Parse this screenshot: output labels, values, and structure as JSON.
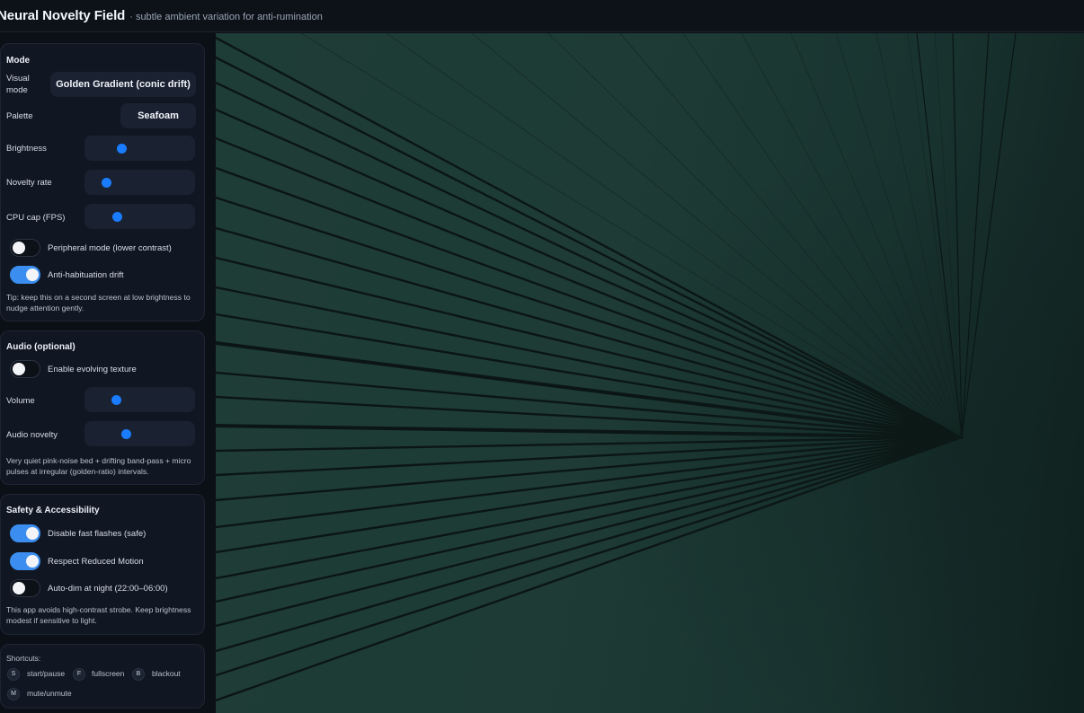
{
  "header": {
    "title": "Neural Novelty Field",
    "subtitle": "· subtle ambient variation for anti-rumination"
  },
  "mode": {
    "title": "Mode",
    "visual_mode_label": "Visual mode",
    "visual_mode_value": "Golden Gradient (conic drift)",
    "palette_label": "Palette",
    "palette_value": "Seafoam",
    "brightness_label": "Brightness",
    "brightness_value": 0.34,
    "novelty_rate_label": "Novelty rate",
    "novelty_rate_value": 0.2,
    "cpu_cap_label": "CPU cap (FPS)",
    "cpu_cap_value": 0.3,
    "peripheral_label": "Peripheral mode (lower contrast)",
    "peripheral_on": false,
    "anti_habituation_label": "Anti-habituation drift",
    "anti_habituation_on": true,
    "tip": "Tip: keep this on a second screen at low brightness to nudge attention gently."
  },
  "audio": {
    "title": "Audio (optional)",
    "enable_label": "Enable evolving texture",
    "enable_on": false,
    "volume_label": "Volume",
    "volume_value": 0.29,
    "audio_novelty_label": "Audio novelty",
    "audio_novelty_value": 0.38,
    "note": "Very quiet pink-noise bed + drifting band-pass + micro pulses at irregular (golden-ratio) intervals."
  },
  "safety": {
    "title": "Safety & Accessibility",
    "flashes_label": "Disable fast flashes (safe)",
    "flashes_on": true,
    "reduced_motion_label": "Respect Reduced Motion",
    "reduced_motion_on": true,
    "autodim_label": "Auto-dim at night (22:00–06:00)",
    "autodim_on": false,
    "note": "This app avoids high-contrast strobe. Keep brightness modest if sensitive to light."
  },
  "shortcuts": {
    "title": "Shortcuts:",
    "items": [
      {
        "key": "S",
        "label": "start/pause"
      },
      {
        "key": "F",
        "label": "fullscreen"
      },
      {
        "key": "B",
        "label": "blackout"
      },
      {
        "key": "M",
        "label": "mute/unmute"
      }
    ]
  },
  "colors": {
    "accent": "#1a7cff",
    "toggle_on": "#3b8ef0",
    "canvas_base": "#1e3b35"
  }
}
